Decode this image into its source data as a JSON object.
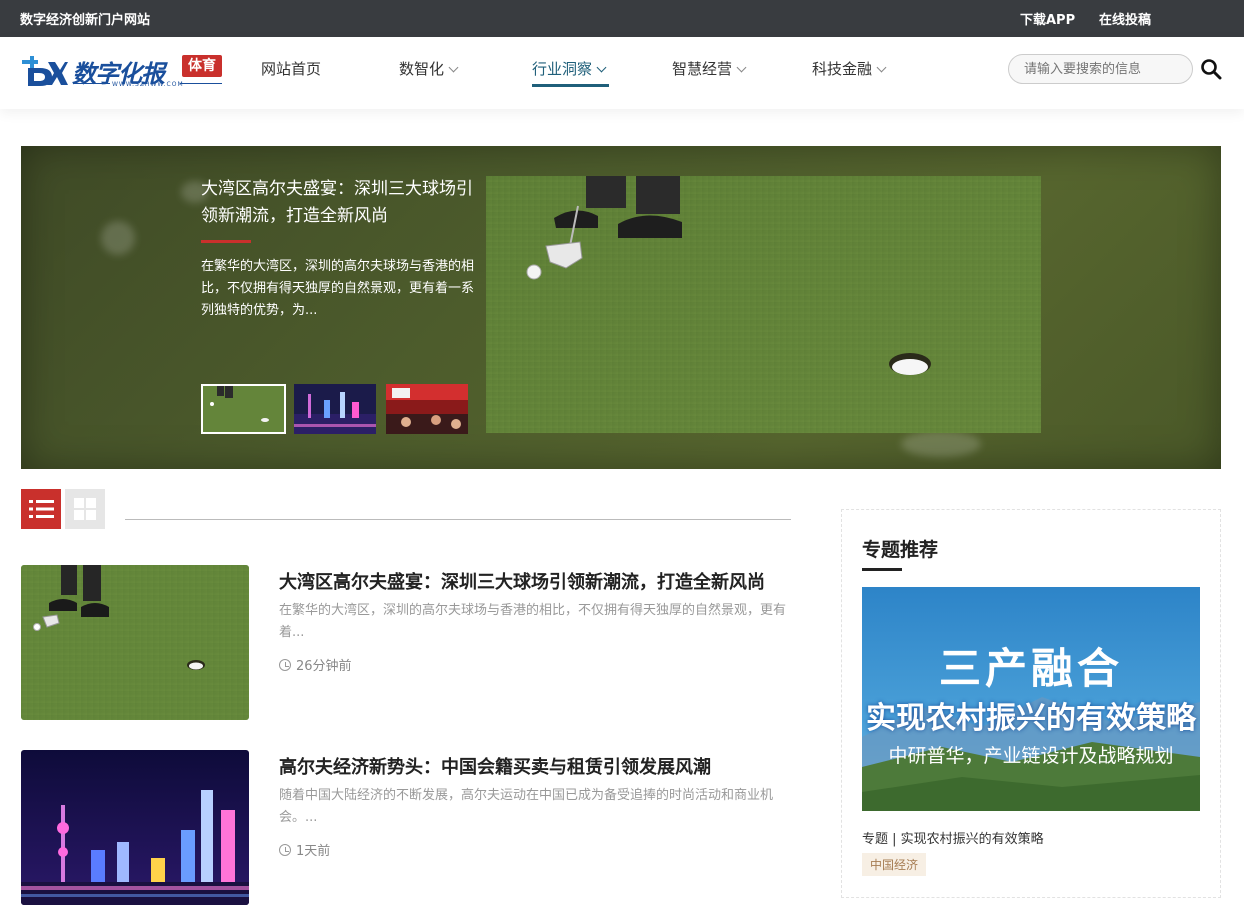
{
  "topbar": {
    "site_name": "数字经济创新门户网站",
    "download_app": "下载APP",
    "submit": "在线投稿"
  },
  "logo": {
    "text": "数字化报",
    "badge": "体育",
    "url": "WWW.SZHWW.COM"
  },
  "nav": {
    "items": [
      {
        "label": "网站首页",
        "has_dropdown": false
      },
      {
        "label": "数智化",
        "has_dropdown": true
      },
      {
        "label": "行业洞察",
        "has_dropdown": true,
        "active": true
      },
      {
        "label": "智慧经营",
        "has_dropdown": true
      },
      {
        "label": "科技金融",
        "has_dropdown": true
      }
    ]
  },
  "search": {
    "placeholder": "请输入要搜索的信息",
    "icon": "search-icon"
  },
  "hero": {
    "title": "大湾区高尔夫盛宴：深圳三大球场引领新潮流，打造全新风尚",
    "description": "在繁华的大湾区，深圳的高尔夫球场与香港的相比，不仅拥有得天独厚的自然景观，更有着一系列独特的优势，为...",
    "thumbnails": [
      "golf-putting",
      "city-night-skyline",
      "red-event-stage"
    ],
    "selected_thumbnail": 0,
    "accent_color": "#c9302c"
  },
  "view_toggle": {
    "list_icon": "list-icon",
    "grid_icon": "grid-icon",
    "active": "list"
  },
  "articles": [
    {
      "title": "大湾区高尔夫盛宴：深圳三大球场引领新潮流，打造全新风尚",
      "desc": "在繁华的大湾区，深圳的高尔夫球场与香港的相比，不仅拥有得天独厚的自然景观，更有着...",
      "time": "26分钟前",
      "image": "golf-putting"
    },
    {
      "title": "高尔夫经济新势头：中国会籍买卖与租赁引领发展风潮",
      "desc": "随着中国大陆经济的不断发展，高尔夫运动在中国已成为备受追捧的时尚活动和商业机会。...",
      "time": "1天前",
      "image": "city-night-skyline"
    }
  ],
  "sidebar": {
    "title": "专题推荐",
    "banner": {
      "line1": "三产融合",
      "line2": "实现农村振兴的有效策略",
      "line3": "中研普华，产业链设计及战略规划"
    },
    "caption": "专题 | 实现农村振兴的有效策略",
    "tag": "中国经济"
  }
}
